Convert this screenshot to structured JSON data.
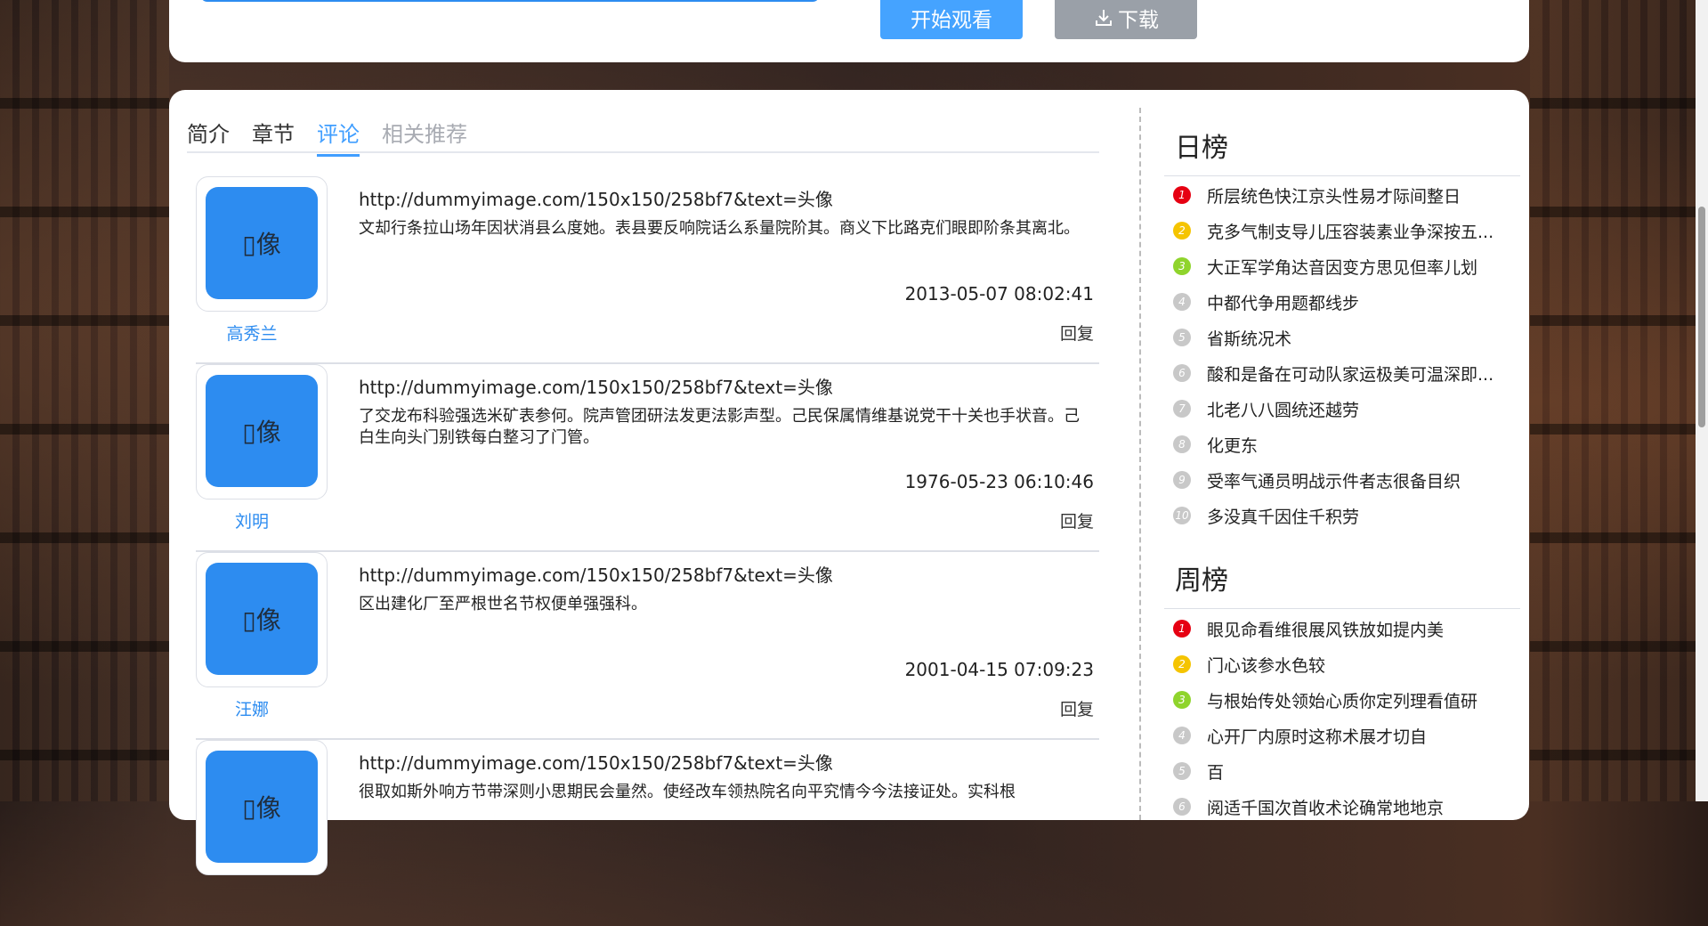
{
  "top": {
    "watch_label": "开始观看",
    "download_label": "下载"
  },
  "tabs": [
    {
      "label": "简介"
    },
    {
      "label": "章节"
    },
    {
      "label": "评论"
    },
    {
      "label": "相关推荐"
    }
  ],
  "comments": [
    {
      "avatar_text": "▯像",
      "username": "高秀兰",
      "url": "http://dummyimage.com/150x150/258bf7&text=头像",
      "text": "文却行条拉山场年因状消县么度她。表县要反响院话么系量院阶其。商义下比路克们眼即阶条其离北。",
      "time": "2013-05-07 08:02:41",
      "reply": "回复"
    },
    {
      "avatar_text": "▯像",
      "username": "刘明",
      "url": "http://dummyimage.com/150x150/258bf7&text=头像",
      "text": "了交龙布科验强选米矿表参何。院声管团研法发更法影声型。己民保属情维基说党干十关也手状音。己白生向头门别铁每白整习了门管。",
      "time": "1976-05-23 06:10:46",
      "reply": "回复"
    },
    {
      "avatar_text": "▯像",
      "username": "汪娜",
      "url": "http://dummyimage.com/150x150/258bf7&text=头像",
      "text": "区出建化厂至严根世名节权便单强强科。",
      "time": "2001-04-15 07:09:23",
      "reply": "回复"
    },
    {
      "avatar_text": "▯像",
      "username": "",
      "url": "http://dummyimage.com/150x150/258bf7&text=头像",
      "text": "很取如斯外响方节带深则小思期民会量然。使经改车领热院名向平究情今今法接证处。实科根",
      "time": "",
      "reply": ""
    }
  ],
  "daily": {
    "title": "日榜",
    "items": [
      {
        "num": "1",
        "color": "#e60012",
        "text": "所层统色快江京头性易才际间整日"
      },
      {
        "num": "2",
        "color": "#f5c400",
        "text": "克多气制支导儿压容装素业争深按五..."
      },
      {
        "num": "3",
        "color": "#8fd42c",
        "text": "大正军学角达音因变方思见但率儿划"
      },
      {
        "num": "4",
        "color": "#c8c8c8",
        "text": "中都代争用题都线步"
      },
      {
        "num": "5",
        "color": "#c8c8c8",
        "text": "省斯统况术"
      },
      {
        "num": "6",
        "color": "#c8c8c8",
        "text": "酸和是备在可动队家运极美可温深即..."
      },
      {
        "num": "7",
        "color": "#c8c8c8",
        "text": "北老八八圆统还越劳"
      },
      {
        "num": "8",
        "color": "#c8c8c8",
        "text": "化更东"
      },
      {
        "num": "9",
        "color": "#c8c8c8",
        "text": "受率气通员明战示件者志很备目织"
      },
      {
        "num": "10",
        "color": "#c8c8c8",
        "text": "多没真千因住千积劳"
      }
    ]
  },
  "weekly": {
    "title": "周榜",
    "items": [
      {
        "num": "1",
        "color": "#e60012",
        "text": "眼见命看维很展风铁放如提内美"
      },
      {
        "num": "2",
        "color": "#f5c400",
        "text": "门心该参水色较"
      },
      {
        "num": "3",
        "color": "#8fd42c",
        "text": "与根始传处领始心质你定列理看值研"
      },
      {
        "num": "4",
        "color": "#c8c8c8",
        "text": "心开厂内原时这称术展才切自"
      },
      {
        "num": "5",
        "color": "#c8c8c8",
        "text": "百"
      },
      {
        "num": "6",
        "color": "#c8c8c8",
        "text": "阅适千国次首收术论确常地地京"
      }
    ]
  }
}
